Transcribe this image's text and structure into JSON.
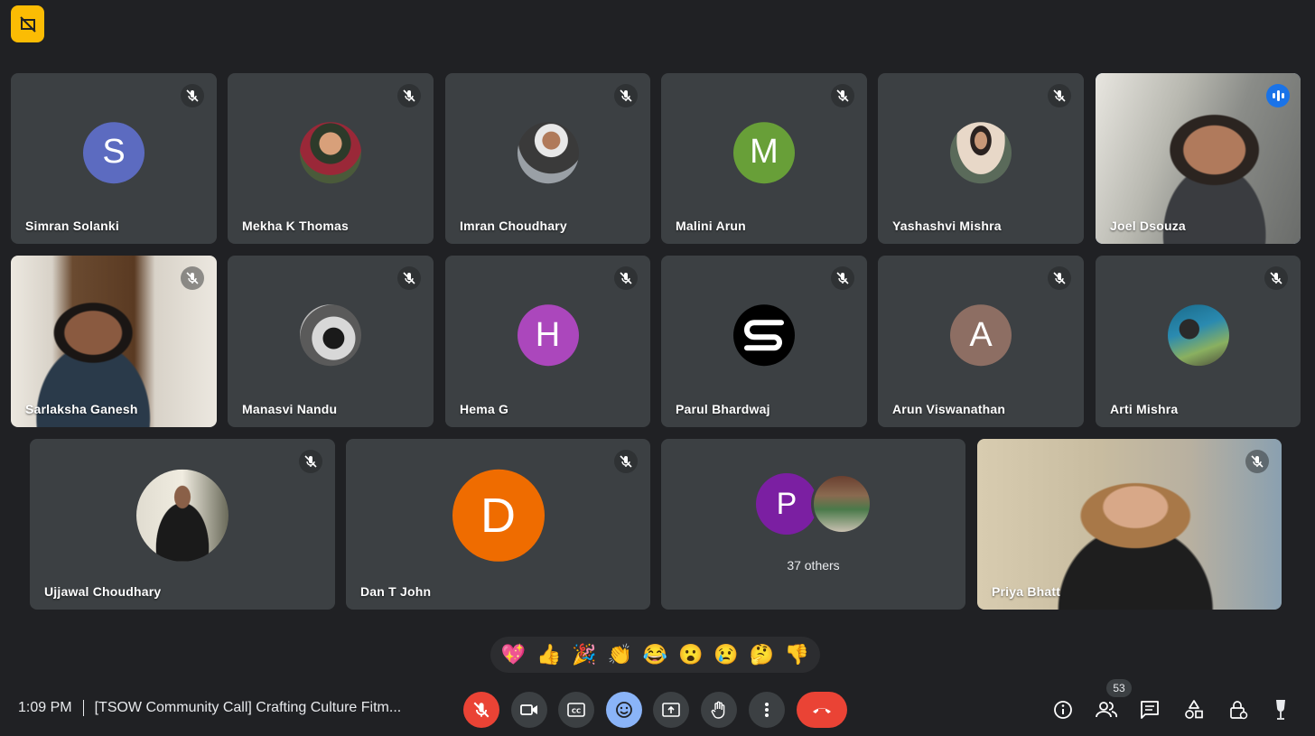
{
  "participants": [
    {
      "name": "Simran Solanki",
      "initial": "S",
      "color": "#5c6bc0"
    },
    {
      "name": "Mekha K Thomas"
    },
    {
      "name": "Imran Choudhary"
    },
    {
      "name": "Malini Arun",
      "initial": "M",
      "color": "#689f38"
    },
    {
      "name": "Yashashvi Mishra"
    },
    {
      "name": "Joel Dsouza"
    },
    {
      "name": "Sarlaksha Ganesh"
    },
    {
      "name": "Manasvi Nandu"
    },
    {
      "name": "Hema G",
      "initial": "H",
      "color": "#ab47bc"
    },
    {
      "name": "Parul Bhardwaj"
    },
    {
      "name": "Arun Viswanathan",
      "initial": "A",
      "color": "#8d6e63"
    },
    {
      "name": "Arti Mishra"
    },
    {
      "name": "Ujjawal Choudhary"
    },
    {
      "name": "Dan T John",
      "initial": "D",
      "color": "#ef6c00"
    },
    {
      "name": "Priya Bhatt"
    }
  ],
  "others": {
    "label": "37 others",
    "initial": "P",
    "color": "#7b1fa2"
  },
  "reactions": [
    "💖",
    "👍",
    "🎉",
    "👏",
    "😂",
    "😮",
    "😢",
    "🤔",
    "👎"
  ],
  "meeting": {
    "time": "1:09 PM",
    "title": "[TSOW Community Call] Crafting Culture Fitm..."
  },
  "people_count": "53",
  "colors": {
    "background": "#202124",
    "tile": "#3c4043",
    "active_outline": "#8ab4f8",
    "hangup": "#ea4335",
    "badge": "#fbbc04"
  }
}
